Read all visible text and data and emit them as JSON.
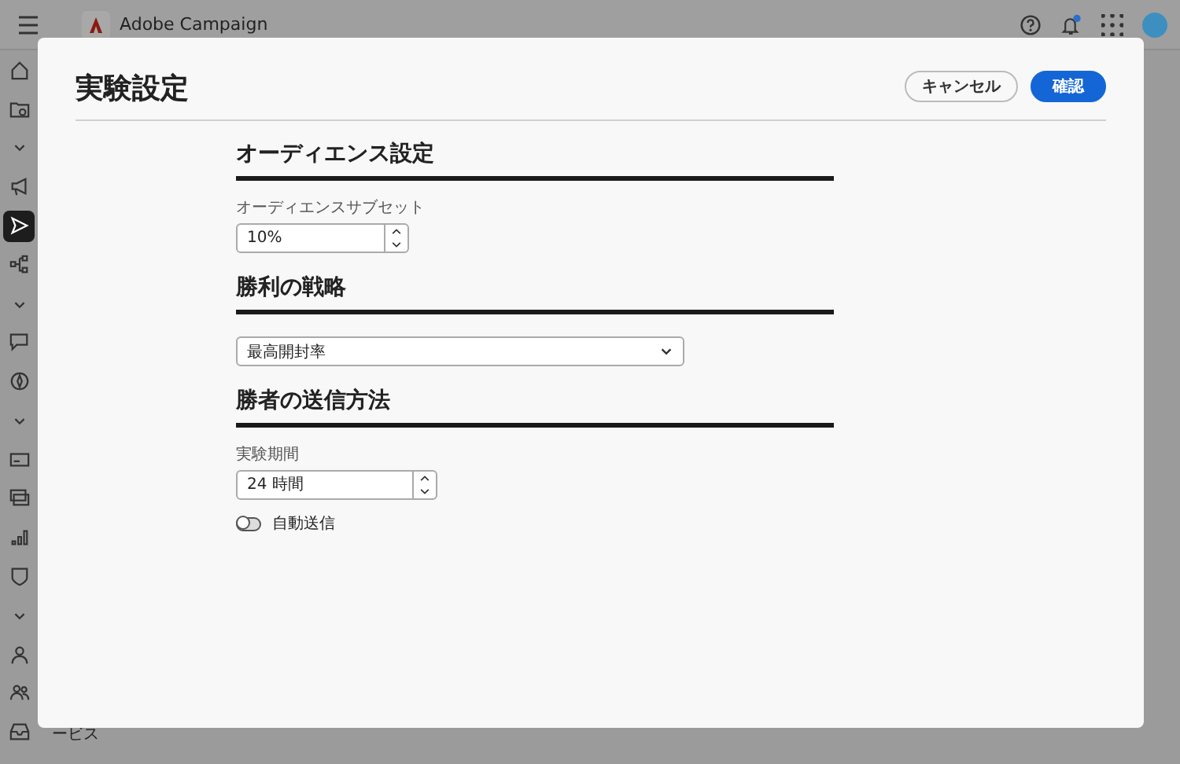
{
  "app": {
    "title": "Adobe Campaign",
    "footer_text": "ービス"
  },
  "sidebar": {
    "items": [
      {
        "kind": "home",
        "selected": false
      },
      {
        "kind": "folder",
        "selected": false
      },
      {
        "kind": "chevron",
        "selected": false
      },
      {
        "kind": "megaphone",
        "selected": false
      },
      {
        "kind": "send",
        "selected": true
      },
      {
        "kind": "hierarchy",
        "selected": false
      },
      {
        "kind": "chevron",
        "selected": false
      },
      {
        "kind": "chat",
        "selected": false
      },
      {
        "kind": "compass",
        "selected": false
      },
      {
        "kind": "chevron",
        "selected": false
      },
      {
        "kind": "card",
        "selected": false
      },
      {
        "kind": "cards",
        "selected": false
      },
      {
        "kind": "chart",
        "selected": false
      },
      {
        "kind": "shield",
        "selected": false
      },
      {
        "kind": "chevron",
        "selected": false
      },
      {
        "kind": "person",
        "selected": false
      },
      {
        "kind": "people",
        "selected": false
      },
      {
        "kind": "inbox",
        "selected": false
      }
    ]
  },
  "dialog": {
    "title": "実験設定",
    "buttons": [
      {
        "label": "キャンセル",
        "kind": "secondary"
      },
      {
        "label": "確認",
        "kind": "primary"
      }
    ],
    "sections": [
      {
        "heading": "オーディエンス設定",
        "fields": [
          {
            "kind": "number",
            "label": "オーディエンスサブセット",
            "value": "10%"
          }
        ]
      },
      {
        "heading": "勝利の戦略",
        "fields": [
          {
            "kind": "dropdown",
            "value": "最高開封率"
          }
        ]
      },
      {
        "heading": "勝者の送信方法",
        "fields": [
          {
            "kind": "number",
            "label": "実験期間",
            "value": "24 時間"
          },
          {
            "kind": "toggle",
            "label": "自動送信",
            "on": false
          }
        ]
      }
    ]
  }
}
